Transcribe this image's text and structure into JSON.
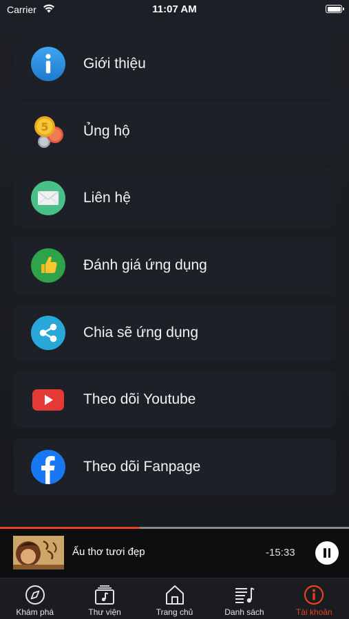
{
  "status_bar": {
    "carrier": "Carrier",
    "time": "11:07 AM"
  },
  "menu": {
    "items": [
      {
        "label": "Giới thiệu",
        "icon": "info-icon",
        "color": "#2f8fe0"
      },
      {
        "label": "Ủng hộ",
        "icon": "coins-icon",
        "color": "#f2c230"
      },
      {
        "label": "Liên hệ",
        "icon": "mail-icon",
        "color": "#4bbf8a"
      },
      {
        "label": "Đánh giá ứng dụng",
        "icon": "thumbs-up-icon",
        "color": "#2ea349"
      },
      {
        "label": "Chia sẽ ứng dụng",
        "icon": "share-icon",
        "color": "#27a8d8"
      },
      {
        "label": "Theo dõi Youtube",
        "icon": "youtube-icon",
        "color": "#e53935"
      },
      {
        "label": "Theo dõi Fanpage",
        "icon": "facebook-icon",
        "color": "#1877f2"
      }
    ]
  },
  "player": {
    "title": "Ấu thơ tươi đẹp",
    "time_remaining": "-15:33",
    "progress": 0.4,
    "accent": "#e8421c"
  },
  "tab_bar": {
    "tabs": [
      {
        "label": "Khám phá",
        "icon": "compass-icon",
        "active": false
      },
      {
        "label": "Thư viện",
        "icon": "library-icon",
        "active": false
      },
      {
        "label": "Trang chủ",
        "icon": "home-icon",
        "active": false
      },
      {
        "label": "Danh sách",
        "icon": "playlist-icon",
        "active": false
      },
      {
        "label": "Tài khoản",
        "icon": "account-info-icon",
        "active": true
      }
    ]
  }
}
